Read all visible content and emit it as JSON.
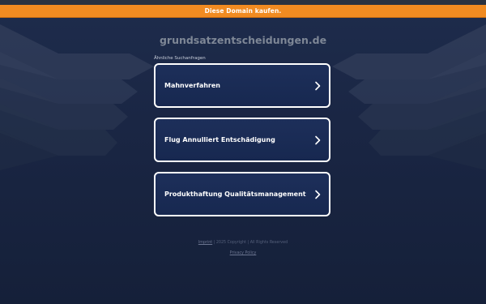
{
  "banner": {
    "label": "Diese Domain kaufen."
  },
  "header": {
    "domain": "grundsatzentscheidungen.de"
  },
  "related": {
    "heading": "Ähnliche Suchanfragen",
    "items": [
      {
        "label": "Mahnverfahren"
      },
      {
        "label": "Flug Annulliert Entschädigung"
      },
      {
        "label": "Produkthaftung Qualitätsmanagement"
      }
    ]
  },
  "footer": {
    "imprint_label": "Imprint",
    "copyright": " | 2025 Copyright | All Rights Reserved",
    "privacy_label": "Privacy Policy"
  },
  "colors": {
    "banner": "#f18b21",
    "background": "#1a2642",
    "card_border": "#ffffff",
    "card_fill": "#1b2d56"
  },
  "icons": {
    "card_arrow": "chevron-right-icon"
  }
}
